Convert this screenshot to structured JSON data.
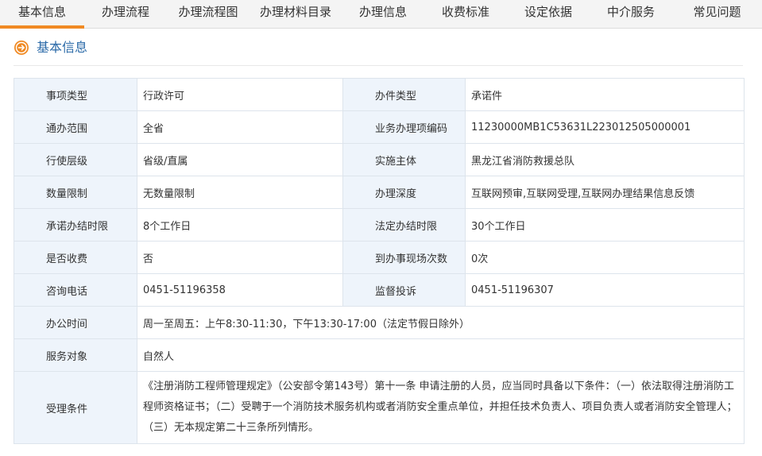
{
  "tabs": [
    {
      "label": "基本信息",
      "active": true
    },
    {
      "label": "办理流程"
    },
    {
      "label": "办理流程图"
    },
    {
      "label": "办理材料目录"
    },
    {
      "label": "办理信息"
    },
    {
      "label": "收费标准"
    },
    {
      "label": "设定依据"
    },
    {
      "label": "中介服务"
    },
    {
      "label": "常见问题"
    }
  ],
  "section": {
    "title": "基本信息",
    "icon": "circle-arrow-right-icon"
  },
  "colors": {
    "accent": "#f08a24",
    "label_bg": "#eef4fb",
    "title": "#2b6aa8"
  },
  "rows": [
    {
      "l1": "事项类型",
      "v1": "行政许可",
      "l2": "办件类型",
      "v2": "承诺件"
    },
    {
      "l1": "通办范围",
      "v1": "全省",
      "l2": "业务办理项编码",
      "v2": "11230000MB1C53631L223012505000001"
    },
    {
      "l1": "行使层级",
      "v1": "省级/直属",
      "l2": "实施主体",
      "v2": "黑龙江省消防救援总队"
    },
    {
      "l1": "数量限制",
      "v1": "无数量限制",
      "l2": "办理深度",
      "v2": "互联网预审,互联网受理,互联网办理结果信息反馈"
    },
    {
      "l1": "承诺办结时限",
      "v1": "8个工作日",
      "l2": "法定办结时限",
      "v2": "30个工作日"
    },
    {
      "l1": "是否收费",
      "v1": "否",
      "l2": "到办事现场次数",
      "v2": "0次"
    },
    {
      "l1": "咨询电话",
      "v1": "0451-51196358",
      "l2": "监督投诉",
      "v2": "0451-51196307"
    }
  ],
  "office_hours": {
    "label": "办公时间",
    "value": "周一至周五：上午8:30-11:30，下午13:30-17:00（法定节假日除外）"
  },
  "service_target": {
    "label": "服务对象",
    "value": "自然人"
  },
  "conditions": {
    "label": "受理条件",
    "value": "《注册消防工程师管理规定》（公安部令第143号）第十一条 申请注册的人员，应当同时具备以下条件：（一）依法取得注册消防工程师资格证书；（二）受聘于一个消防技术服务机构或者消防安全重点单位，并担任技术负责人、项目负责人或者消防安全管理人；（三）无本规定第二十三条所列情形。"
  }
}
